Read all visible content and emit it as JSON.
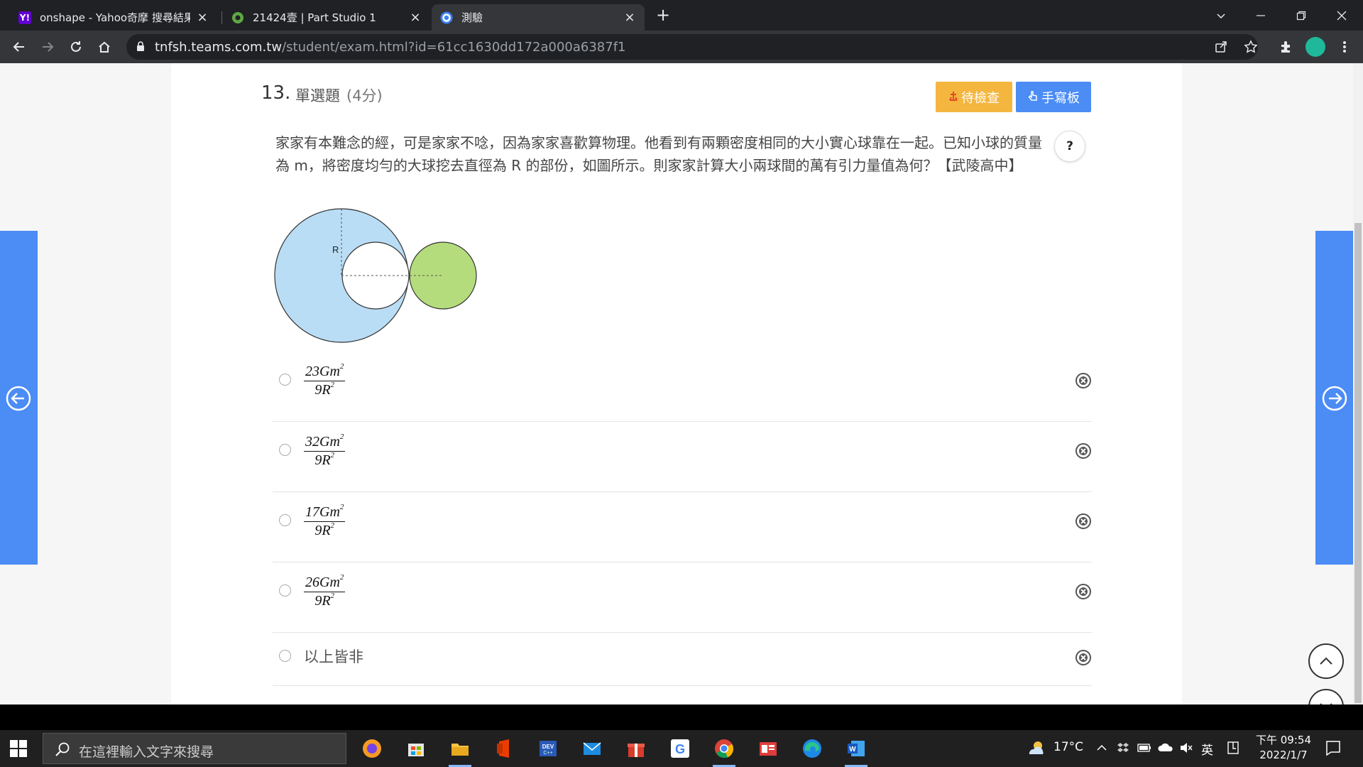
{
  "browser": {
    "tabs": [
      {
        "title": "onshape - Yahoo奇摩 搜尋結果",
        "favicon": "yahoo-icon"
      },
      {
        "title": "21424壹 | Part Studio 1",
        "favicon": "onshape-icon"
      },
      {
        "title": "測驗",
        "favicon": "teams-icon"
      }
    ],
    "url_host": "tnfsh.teams.com.tw",
    "url_path": "/student/exam.html?id=61cc1630dd172a000a6387f1"
  },
  "question": {
    "number": "13.",
    "type": "單選題",
    "score": "(4分)",
    "review_label": "待檢查",
    "pad_label": "手寫板",
    "help": "?",
    "text": "家家有本難念的經，可是家家不唸，因為家家喜歡算物理。他看到有兩顆密度相同的大小實心球靠在一起。已知小球的質量為 m，將密度均勻的大球挖去直徑為 R 的部份，如圖所示。則家家計算大小兩球間的萬有引力量值為何？【武陵高中】",
    "figure_label": "R"
  },
  "options": [
    {
      "num": "23Gm",
      "den": "9R"
    },
    {
      "num": "32Gm",
      "den": "9R"
    },
    {
      "num": "17Gm",
      "den": "9R"
    },
    {
      "num": "26Gm",
      "den": "9R"
    },
    {
      "text": "以上皆非"
    }
  ],
  "taskbar": {
    "search_placeholder": "在這裡輸入文字來搜尋",
    "temperature": "17°C",
    "ime": "英",
    "time": "下午 09:54",
    "date": "2022/1/7"
  },
  "colors": {
    "accent_blue": "#4b8cf5",
    "review_orange": "#f4b63e",
    "big_sphere": "#b9ddf5",
    "small_sphere": "#b5dc7c"
  }
}
